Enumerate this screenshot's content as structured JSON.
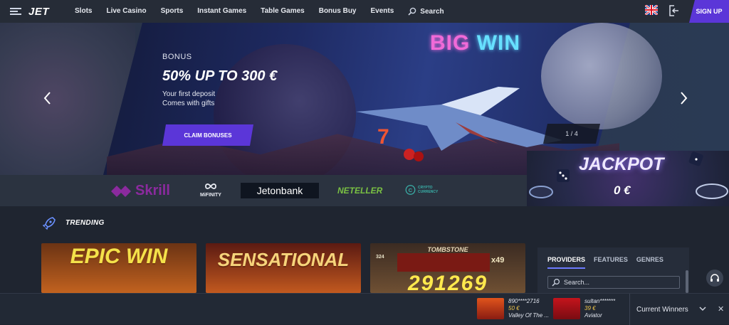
{
  "header": {
    "logo": "JET",
    "nav": [
      "Slots",
      "Live Casino",
      "Sports",
      "Instant Games",
      "Table Games",
      "Bonus Buy",
      "Events"
    ],
    "search_label": "Search",
    "signup_label": "SIGN UP",
    "language": "English (UK flag)"
  },
  "hero": {
    "bonus_label": "BONUS",
    "title": "50% UP TO 300 €",
    "subtitle_line1": "Your first deposit",
    "subtitle_line2": "Comes with gifts",
    "cta_label": "CLAIM BONUSES",
    "big_word": "BIG",
    "win_word": "WIN",
    "pager": "1 / 4"
  },
  "payments": [
    "Skrill",
    "MiFINITY",
    "Jetonbank",
    "NETELLER",
    "CRYPTO CURRENCY"
  ],
  "jackpot": {
    "title": "JACKPOT",
    "value": "0 €"
  },
  "trending": {
    "title": "TRENDING",
    "games": [
      {
        "name": "EPIC WIN",
        "colors": [
          "#5a2a16",
          "#a4531e"
        ]
      },
      {
        "name": "SENSATIONAL",
        "colors": [
          "#6a1f14",
          "#c25a23"
        ]
      },
      {
        "name": "TOMBSTONE",
        "colors": [
          "#3a2a24",
          "#7a5a3c"
        ]
      }
    ],
    "game3_digits": "291269",
    "game3_x": "x49",
    "game3_left": "324"
  },
  "providers_panel": {
    "tabs": [
      "PROVIDERS",
      "FEATURES",
      "GENRES"
    ],
    "search_placeholder": "Search..."
  },
  "winners": {
    "label": "Current Winners",
    "items": [
      {
        "user": "890****2716",
        "amount": "50 €",
        "game": "Valley Of The ..."
      },
      {
        "user": "sultan*******",
        "amount": "39 €",
        "game": "Aviator"
      }
    ]
  },
  "colors": {
    "accent": "#5b36d8",
    "background": "#1f2530",
    "topbar": "#262c37"
  }
}
